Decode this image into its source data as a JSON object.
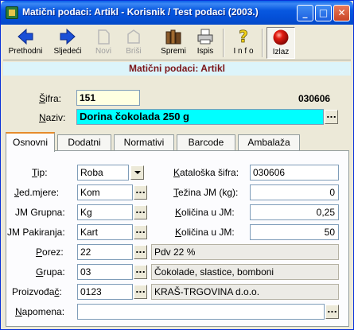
{
  "window": {
    "title": "Matični podaci: Artikl - Korisnik / Test podaci (2003.)",
    "buttons": {
      "minimize": "_",
      "maximize": "□",
      "close": "✕"
    }
  },
  "toolbar": {
    "items": [
      {
        "label": "Prethodni",
        "icon": "arrow-left-icon",
        "enabled": true
      },
      {
        "label": "Sljedeći",
        "icon": "arrow-right-icon",
        "enabled": true
      },
      {
        "label": "Novi",
        "icon": "new-document-icon",
        "enabled": false
      },
      {
        "label": "Briši",
        "icon": "delete-icon",
        "enabled": false
      },
      {
        "label": "Spremi",
        "icon": "save-books-icon",
        "enabled": true
      },
      {
        "label": "Ispis",
        "icon": "printer-icon",
        "enabled": true
      },
      {
        "label": "I n f o",
        "icon": "help-question-icon",
        "enabled": true
      },
      {
        "label": "Izlaz",
        "icon": "exit-red-ball-icon",
        "enabled": true
      }
    ]
  },
  "header": {
    "title": "Matični podaci: Artikl"
  },
  "form": {
    "sifra_label": "Šifra:",
    "sifra_value": "151",
    "code_right": "030606",
    "naziv_label": "Naziv:",
    "naziv_value": "Dorina čokolada 250 g",
    "dots": "..."
  },
  "tabs": [
    {
      "label": "Osnovni",
      "active": true
    },
    {
      "label": "Dodatni",
      "active": false
    },
    {
      "label": "Normativi",
      "active": false
    },
    {
      "label": "Barcode",
      "active": false
    },
    {
      "label": "Ambalaža",
      "active": false
    }
  ],
  "osnovni": {
    "tip_label": "Tip:",
    "tip_value": "Roba",
    "jedmjere_label": "Jed.mjere:",
    "jedmjere_value": "Kom",
    "jmgrupna_label": "JM Grupna:",
    "jmgrupna_value": "Kg",
    "jmpakiranja_label": "JM Pakiranja:",
    "jmpakiranja_value": "Kart",
    "porez_label": "Porez:",
    "porez_value": "22",
    "porez_desc": "Pdv 22 %",
    "grupa_label": "Grupa:",
    "grupa_value": "03",
    "grupa_desc": "Čokolade, slastice, bomboni",
    "proizvodac_label": "Proizvođač:",
    "proizvodac_value": "0123",
    "proizvodac_desc": "KRAŠ-TRGOVINA d.o.o.",
    "napomena_label": "Napomena:",
    "napomena_value": "",
    "katsifra_label": "Kataloška šifra:",
    "katsifra_value": "030606",
    "tezina_label": "Težina JM (kg):",
    "tezina_value": "0",
    "kolicina1_label": "Količina u JM:",
    "kolicina1_value": "0,25",
    "kolicina2_label": "Količina u JM:",
    "kolicina2_value": "50"
  },
  "colors": {
    "titlebar": "#0858e0",
    "header_band": "#dcf4fa",
    "header_text": "#7a1418",
    "naziv_bg": "#00ffff",
    "sifra_bg": "#ffffe1"
  }
}
